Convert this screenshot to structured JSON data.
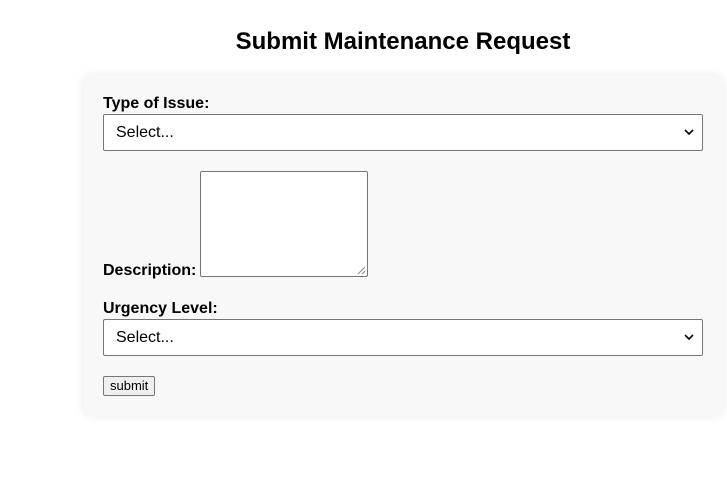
{
  "page": {
    "title": "Submit Maintenance Request"
  },
  "form": {
    "issue_type": {
      "label": "Type of Issue:",
      "selected": "Select..."
    },
    "description": {
      "label": "Description:",
      "value": ""
    },
    "urgency": {
      "label": "Urgency Level:",
      "selected": "Select..."
    },
    "submit_label": "submit"
  },
  "colors": {
    "card_background": "#f8f8f8",
    "control_border": "#767676",
    "button_background": "#efefef"
  },
  "icons": {
    "select_arrow": "chevron-down-icon",
    "resize_handle": "resize-grip-icon"
  }
}
